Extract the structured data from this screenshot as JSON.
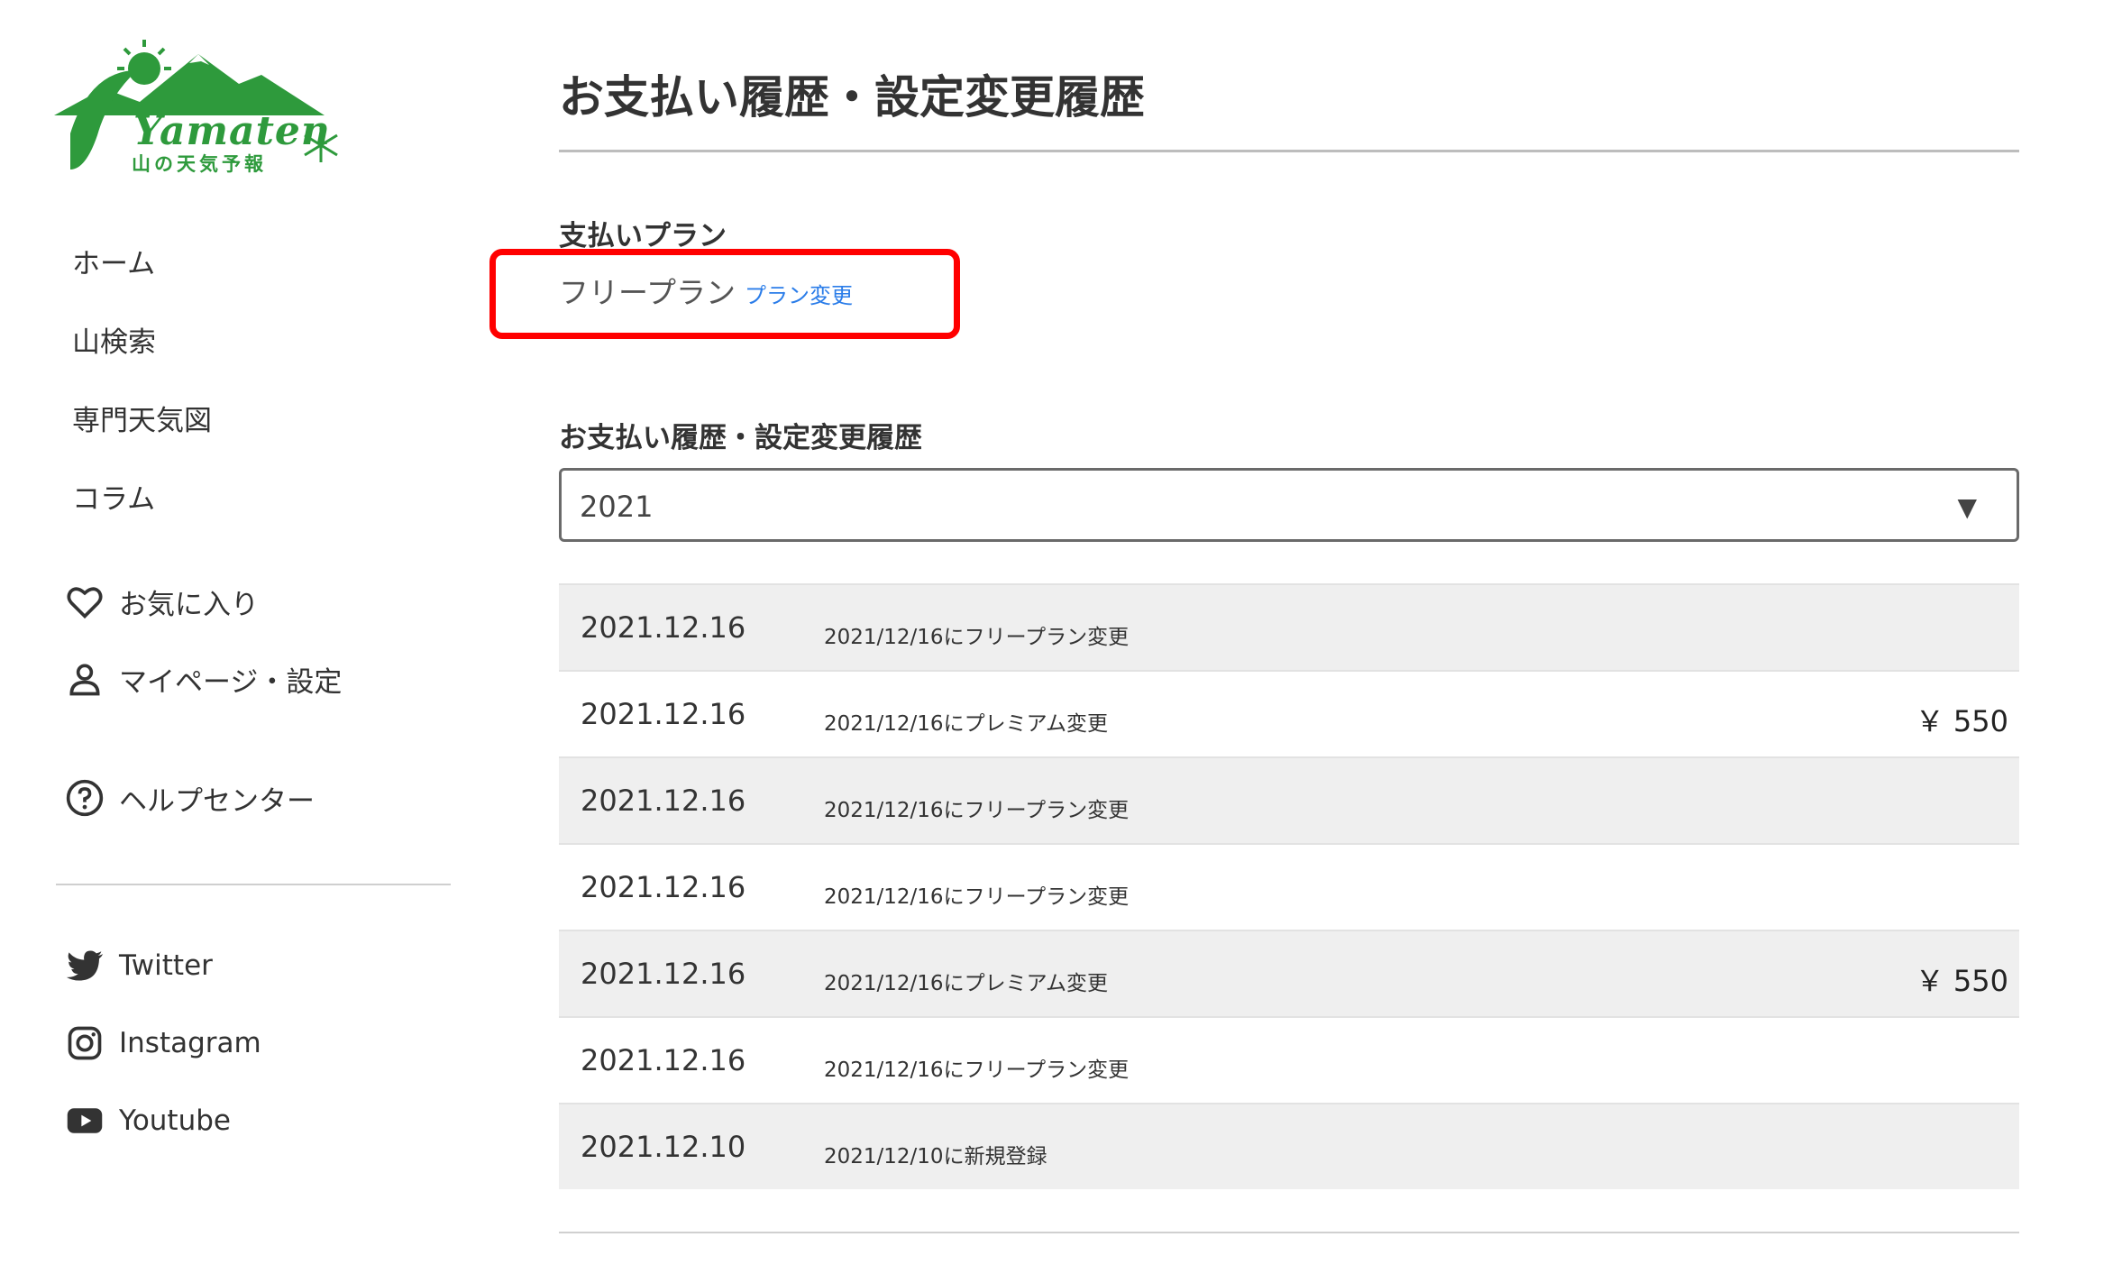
{
  "logo": {
    "wordmark": "Yamaten",
    "subtitle": "山の天気予報"
  },
  "nav": {
    "items": [
      {
        "label": "ホーム"
      },
      {
        "label": "山検索"
      },
      {
        "label": "専門天気図"
      },
      {
        "label": "コラム"
      }
    ],
    "favorites_label": "お気に入り",
    "mypage_label": "マイページ・設定",
    "help_label": "ヘルプセンター"
  },
  "social": {
    "twitter_label": "Twitter",
    "instagram_label": "Instagram",
    "youtube_label": "Youtube"
  },
  "page": {
    "title": "お支払い履歴・設定変更履歴"
  },
  "plan": {
    "heading": "支払いプラン",
    "current": "フリープラン",
    "change_link": "プラン変更"
  },
  "history": {
    "heading": "お支払い履歴・設定変更履歴",
    "selected_year": "2021",
    "rows": [
      {
        "date": "2021.12.16",
        "desc": "2021/12/16にフリープラン変更",
        "amount": ""
      },
      {
        "date": "2021.12.16",
        "desc": "2021/12/16にプレミアム変更",
        "amount": "￥ 550"
      },
      {
        "date": "2021.12.16",
        "desc": "2021/12/16にフリープラン変更",
        "amount": ""
      },
      {
        "date": "2021.12.16",
        "desc": "2021/12/16にフリープラン変更",
        "amount": ""
      },
      {
        "date": "2021.12.16",
        "desc": "2021/12/16にプレミアム変更",
        "amount": "￥ 550"
      },
      {
        "date": "2021.12.16",
        "desc": "2021/12/16にフリープラン変更",
        "amount": ""
      },
      {
        "date": "2021.12.10",
        "desc": "2021/12/10に新規登録",
        "amount": ""
      }
    ]
  },
  "colors": {
    "brand_green": "#2e9a3c",
    "link_blue": "#2b7de9",
    "highlight_red": "#ff0000",
    "row_shade": "#efefef"
  }
}
